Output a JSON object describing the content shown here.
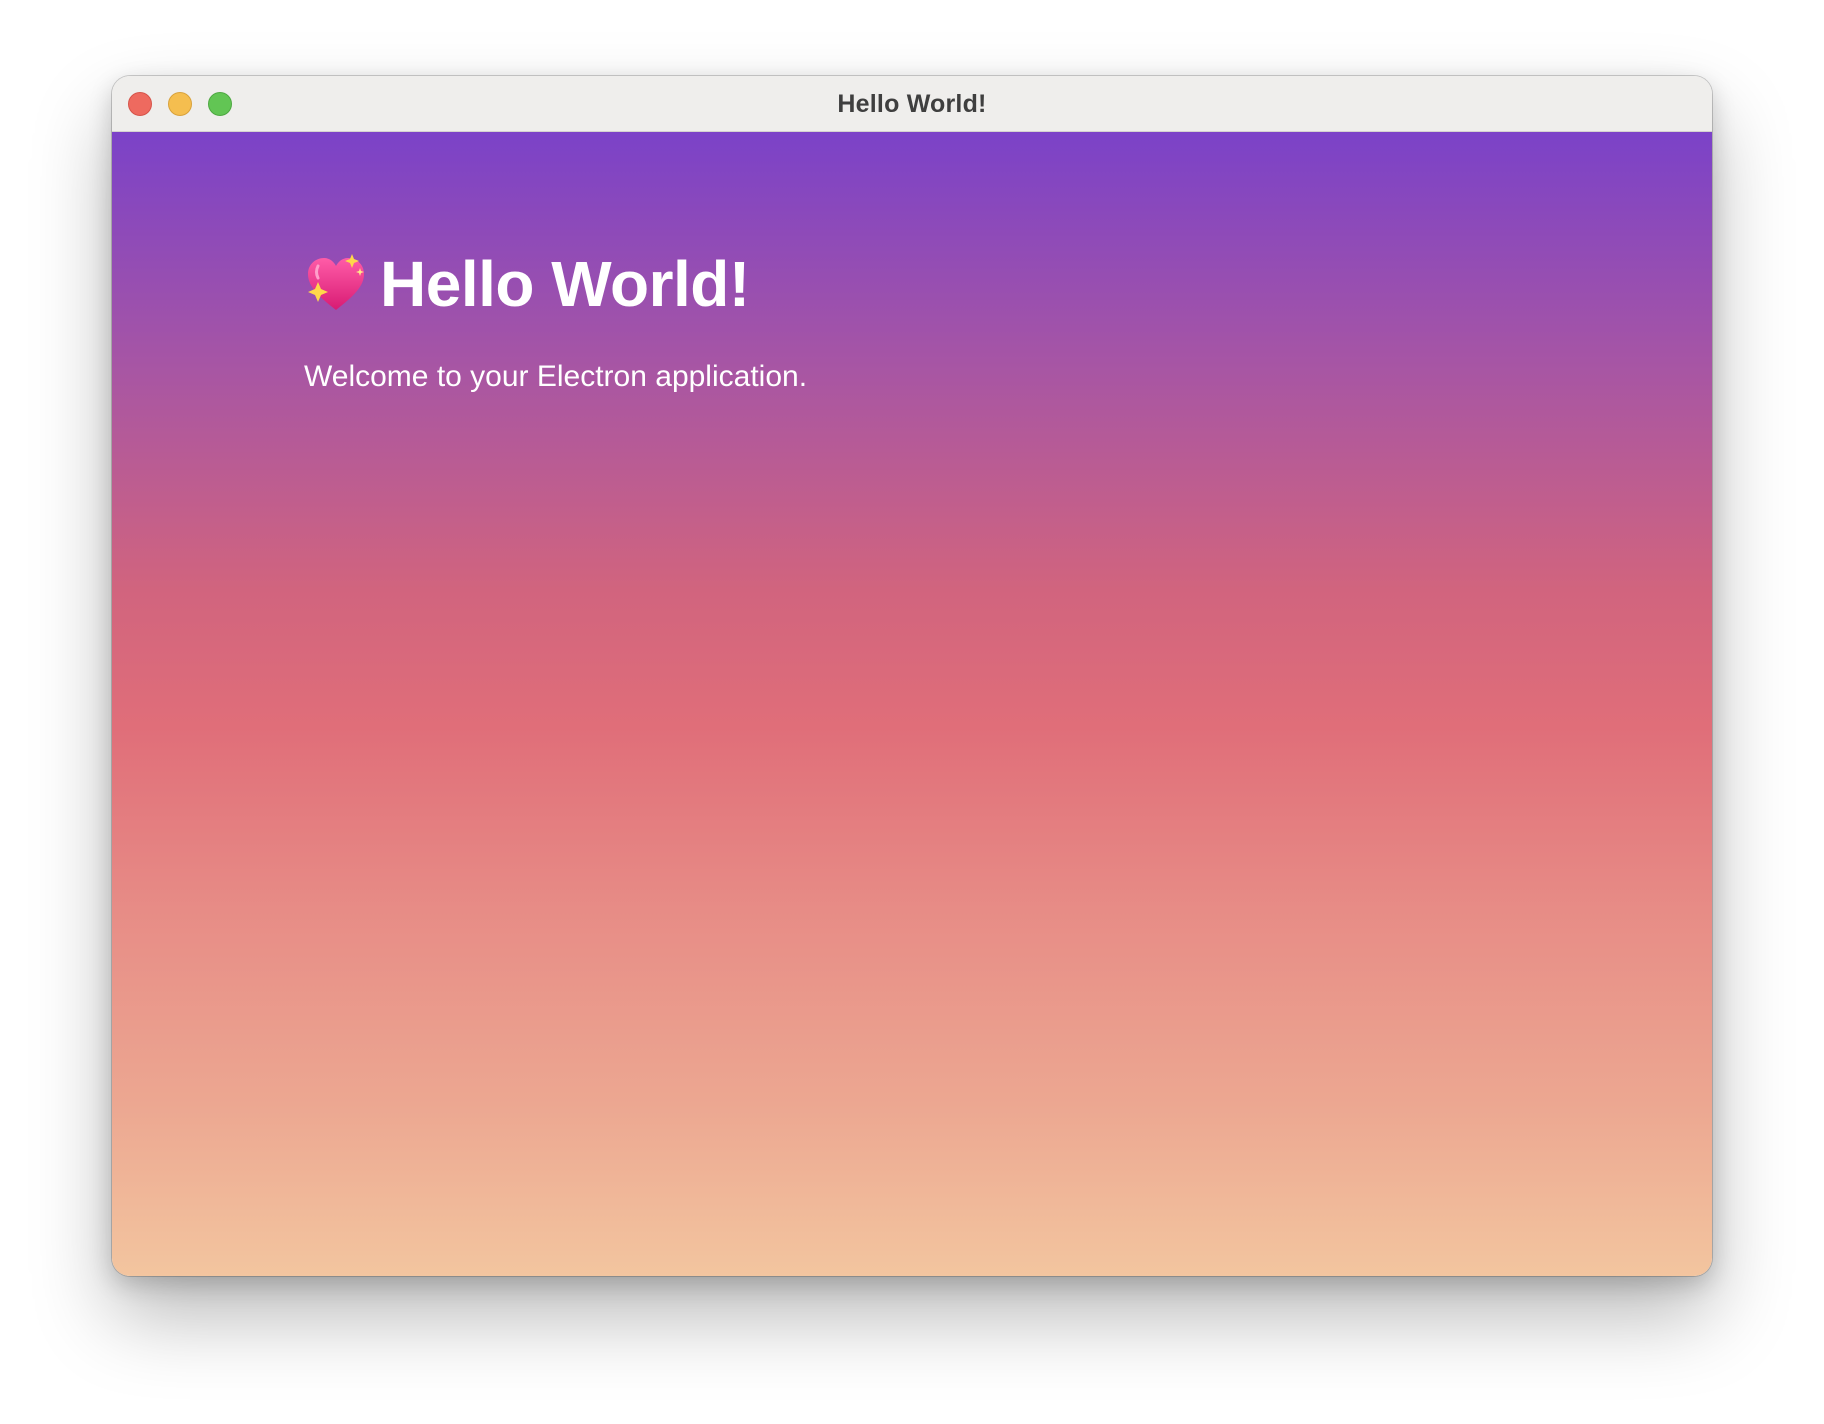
{
  "window": {
    "title": "Hello World!"
  },
  "traffic_lights": {
    "close": "#ee6a5f",
    "minimize": "#f5be4f",
    "maximize": "#62c554"
  },
  "content": {
    "heading_icon": "sparkling-heart-icon",
    "heading": "Hello World!",
    "subtitle": "Welcome to your Electron application.",
    "gradient_colors": [
      "#7b42c8",
      "#e06e79",
      "#f3c59f"
    ]
  }
}
